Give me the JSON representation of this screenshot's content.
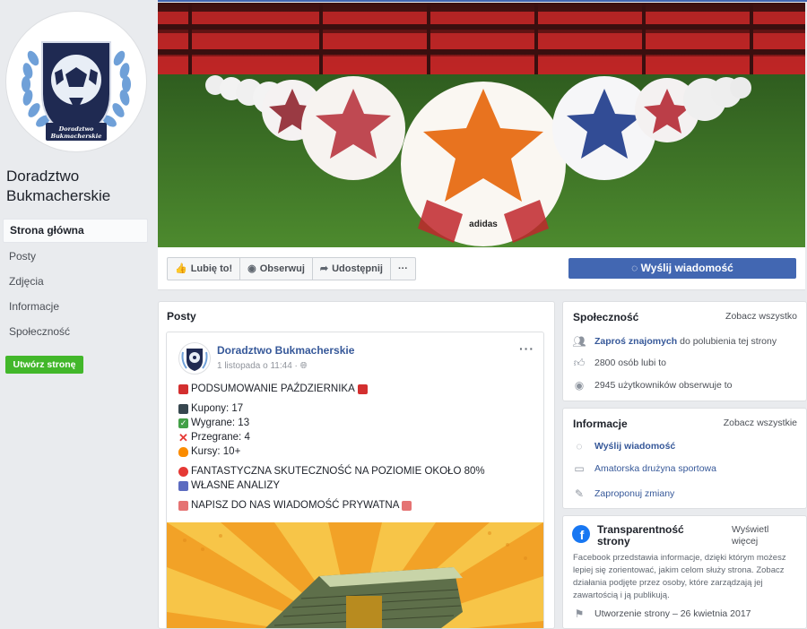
{
  "page": {
    "name": "Doradztwo Bukmacherskie",
    "avatar_badge_text": "Doradztwo Bukmacherskie"
  },
  "sidebar": {
    "items": [
      {
        "label": "Strona główna",
        "active": true
      },
      {
        "label": "Posty"
      },
      {
        "label": "Zdjęcia"
      },
      {
        "label": "Informacje"
      },
      {
        "label": "Społeczność"
      }
    ],
    "create_button": "Utwórz stronę"
  },
  "actions": {
    "like": "Lubię to!",
    "follow": "Obserwuj",
    "share": "Udostępnij",
    "more": "···",
    "send_message": "Wyślij wiadomość"
  },
  "posts": {
    "title": "Posty",
    "post": {
      "author": "Doradztwo Bukmacherskie",
      "time": "1 listopada o 11:44 ·",
      "more": "···",
      "lines": {
        "headline": "PODSUMOWANIE PAŹDZIERNIKA",
        "coupons": "Kupony: 17",
        "wins": "Wygrane: 13",
        "losses": "Przegrane: 4",
        "odds": "Kursy: 10+",
        "effectiveness": "FANTASTYCZNA SKUTECZNOŚĆ NA POZIOMIE OKOŁO 80%",
        "analysis": "WŁASNE ANALIZY",
        "contact": "NAPISZ DO NAS WIADOMOŚĆ PRYWATNA"
      }
    }
  },
  "community": {
    "title": "Społeczność",
    "see_all": "Zobacz wszystko",
    "invite_link": "Zaproś znajomych",
    "invite_rest": "do polubienia tej strony",
    "likes": "2800 osób lubi to",
    "followers": "2945 użytkowników obserwuje to"
  },
  "info": {
    "title": "Informacje",
    "see_all": "Zobacz wszystkie",
    "message": "Wyślij wiadomość",
    "category": "Amatorska drużyna sportowa",
    "suggest": "Zaproponuj zmiany"
  },
  "transparency": {
    "title": "Transparentność strony",
    "show_more": "Wyświetl więcej",
    "text": "Facebook przedstawia informacje, dzięki którym możesz lepiej się zorientować, jakim celom służy strona. Zobacz działania podjęte przez osoby, które zarządzają jej zawartością i ją publikują.",
    "created": "Utworzenie strony – 26 kwietnia 2017"
  },
  "colors": {
    "facebook_blue": "#4267b2",
    "link_blue": "#365899",
    "create_green": "#42b72a"
  }
}
